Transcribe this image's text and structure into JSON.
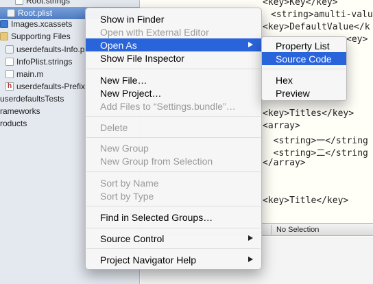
{
  "navigator": {
    "items": [
      {
        "label": "Root.strings",
        "icon": "strings-file-icon"
      },
      {
        "label": "Root.plist",
        "icon": "plist-file-icon",
        "selected": true
      },
      {
        "label": "Images.xcassets",
        "icon": "asset-catalog-icon"
      },
      {
        "label": "Supporting Files",
        "icon": "folder-icon"
      },
      {
        "label": "userdefaults-Info.p",
        "icon": "plist-file-icon"
      },
      {
        "label": "InfoPlist.strings",
        "icon": "strings-file-icon"
      },
      {
        "label": "main.m",
        "icon": "objc-file-icon"
      },
      {
        "label": "userdefaults-Prefix",
        "icon": "header-file-icon"
      },
      {
        "label": "userdefaultsTests",
        "icon": "folder-icon"
      },
      {
        "label": "rameworks",
        "icon": "folder-icon"
      },
      {
        "label": "roducts",
        "icon": "folder-icon"
      }
    ]
  },
  "editor": {
    "lines": [
      {
        "text": "<key>Key</key>"
      },
      {
        "text": "<string>amulti-value"
      },
      {
        "text": "<key>DefaultValue</k"
      },
      {
        "text": "<ey>"
      },
      {
        "text": "<key>Titles</key>"
      },
      {
        "text": "<array>"
      },
      {
        "text": "  <string>一</string"
      },
      {
        "text": "  <string>二</string"
      },
      {
        "text": "</array>"
      },
      {
        "text": "<key>Title</key>"
      }
    ],
    "status_text": "No Selection"
  },
  "context_menu": {
    "items": [
      {
        "label": "Show in Finder",
        "enabled": true
      },
      {
        "label": "Open with External Editor",
        "enabled": false
      },
      {
        "label": "Open As",
        "enabled": true,
        "highlighted": true,
        "submenu": true
      },
      {
        "label": "Show File Inspector",
        "enabled": true
      },
      {
        "label": "New File…",
        "enabled": true
      },
      {
        "label": "New Project…",
        "enabled": true
      },
      {
        "label": "Add Files to “Settings.bundle”…",
        "enabled": false
      },
      {
        "label": "Delete",
        "enabled": false
      },
      {
        "label": "New Group",
        "enabled": false
      },
      {
        "label": "New Group from Selection",
        "enabled": false
      },
      {
        "label": "Sort by Name",
        "enabled": false
      },
      {
        "label": "Sort by Type",
        "enabled": false
      },
      {
        "label": "Find in Selected Groups…",
        "enabled": true
      },
      {
        "label": "Source Control",
        "enabled": true,
        "submenu": true
      },
      {
        "label": "Project Navigator Help",
        "enabled": true,
        "submenu": true
      }
    ]
  },
  "open_as_submenu": {
    "items": [
      {
        "label": "Property List",
        "highlighted": false
      },
      {
        "label": "Source Code",
        "highlighted": true
      },
      {
        "label": "Hex",
        "highlighted": false
      },
      {
        "label": "Preview",
        "highlighted": false
      }
    ]
  },
  "colors": {
    "menu_highlight": "#2a64db",
    "navigator_bg": "#e4e9f0",
    "selection": "#4e7cc4"
  }
}
